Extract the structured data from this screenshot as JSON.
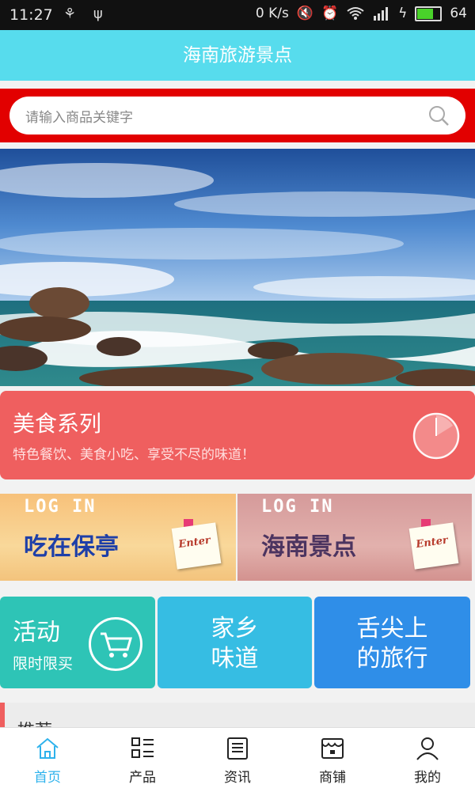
{
  "status_bar": {
    "time": "11:27",
    "net_speed": "0 K/s",
    "battery_level": "64"
  },
  "header": {
    "title": "海南旅游景点"
  },
  "search": {
    "placeholder": "请输入商品关键字"
  },
  "banner": {
    "active_slide": 1,
    "image": "seaside-rocks-waves"
  },
  "food_card": {
    "title": "美食系列",
    "subtitle": "特色餐饮、美食小吃、享受不尽的味道！"
  },
  "login_cards": [
    {
      "login_text": "LOG IN",
      "label": "吃在保亭",
      "note": "Enter"
    },
    {
      "login_text": "LOG IN",
      "label": "海南景点",
      "note": "Enter"
    }
  ],
  "tiles": [
    {
      "title": "活动",
      "subtitle": "限时限买",
      "icon": "shopping-cart-icon",
      "color": "#2ec4b6"
    },
    {
      "line1": "家乡",
      "line2": "味道",
      "color": "#36bde3"
    },
    {
      "line1": "舌尖上",
      "line2": "的旅行",
      "color": "#2f8ee8"
    }
  ],
  "recommend": {
    "label": "推荐"
  },
  "tabbar": {
    "active_color": "#2eb2ec",
    "items": [
      {
        "label": "首页",
        "icon": "home-icon",
        "active": true
      },
      {
        "label": "产品",
        "icon": "grid-list-icon",
        "active": false
      },
      {
        "label": "资讯",
        "icon": "news-icon",
        "active": false
      },
      {
        "label": "商铺",
        "icon": "store-icon",
        "active": false
      },
      {
        "label": "我的",
        "icon": "person-icon",
        "active": false
      }
    ]
  },
  "colors": {
    "header": "#57dced",
    "search_band": "#e20000",
    "food_card": "#ef5f5f"
  }
}
